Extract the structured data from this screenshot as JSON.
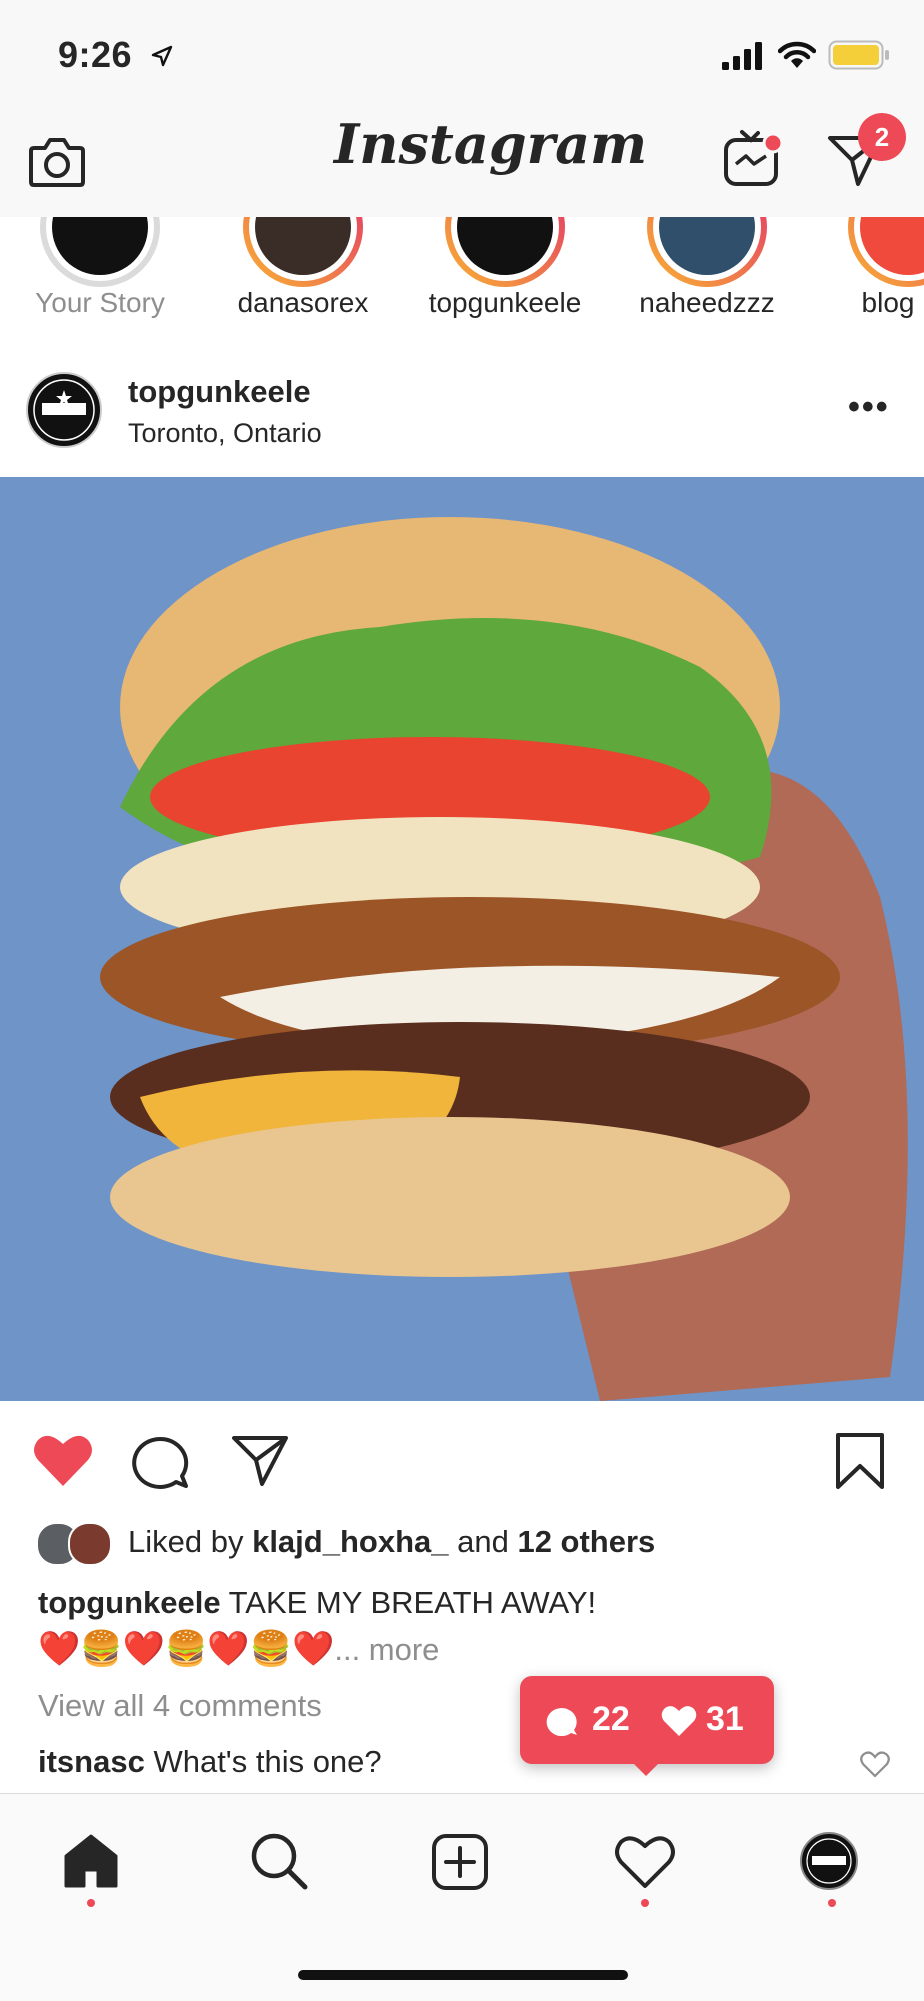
{
  "status_bar": {
    "time": "9:26"
  },
  "header": {
    "app_title": "Instagram",
    "direct_badge_count": "2"
  },
  "stories": [
    {
      "label": "Your Story",
      "own": true
    },
    {
      "label": "danasorex"
    },
    {
      "label": "topgunkeele"
    },
    {
      "label": "naheedzzz"
    },
    {
      "label": "blog"
    }
  ],
  "post": {
    "username": "topgunkeele",
    "location": "Toronto, Ontario",
    "liked_by_prefix": "Liked by ",
    "liked_by_user": "klajd_hoxha_",
    "liked_by_mid": " and ",
    "liked_by_others": "12 others",
    "caption_user": "topgunkeele",
    "caption_text": " TAKE MY BREATH AWAY!",
    "caption_emojis": "❤️🍔❤️🍔❤️🍔❤️",
    "more_label": "... more",
    "view_comments": "View all 4 comments",
    "comment_user": "itsnasc",
    "comment_text": " What's this one?",
    "liked": true
  },
  "activity_bubble": {
    "comments": "22",
    "likes": "31"
  },
  "colors": {
    "accent": "#ed4956",
    "secondary_text": "#8e8e8e",
    "background": "#f8f8f8"
  },
  "icons": [
    "camera-icon",
    "igtv-icon",
    "direct-icon",
    "heart-icon",
    "comment-icon",
    "share-icon",
    "bookmark-icon",
    "home-icon",
    "search-icon",
    "add-post-icon",
    "activity-icon",
    "profile-icon"
  ]
}
